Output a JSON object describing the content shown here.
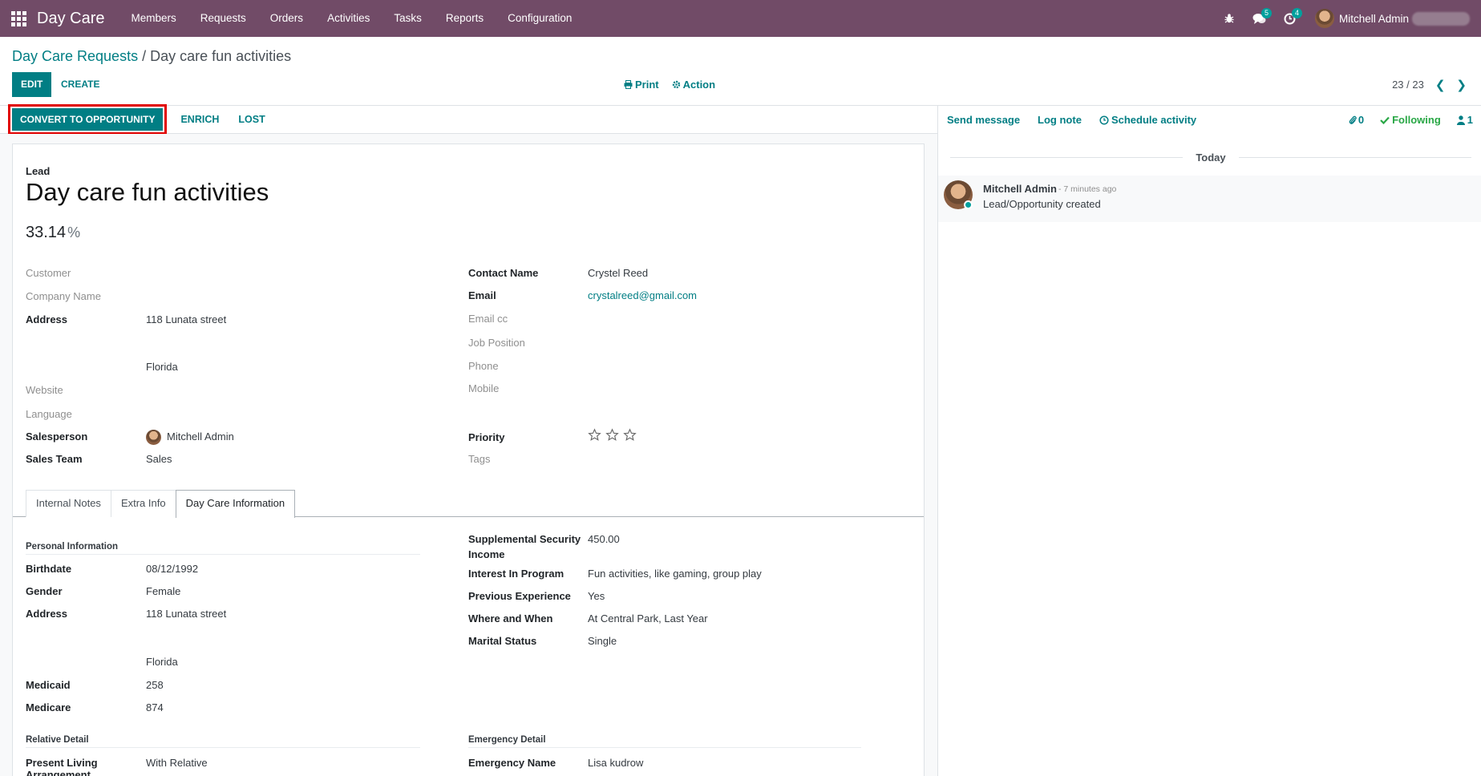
{
  "navbar": {
    "brand": "Day Care",
    "menu": [
      "Members",
      "Requests",
      "Orders",
      "Activities",
      "Tasks",
      "Reports",
      "Configuration"
    ],
    "messages_badge": "5",
    "activities_badge": "4",
    "user_name": "Mitchell Admin"
  },
  "control_panel": {
    "breadcrumb_parent": "Day Care Requests",
    "breadcrumb_sep": " / ",
    "breadcrumb_current": "Day care fun activities",
    "edit_label": "EDIT",
    "create_label": "CREATE",
    "print_label": "Print",
    "action_label": "Action",
    "pager": "23 / 23"
  },
  "statusbar": {
    "convert_label": "CONVERT TO OPPORTUNITY",
    "enrich_label": "ENRICH",
    "lost_label": "LOST"
  },
  "lead": {
    "type_label": "Lead",
    "title": "Day care fun activities",
    "probability": "33.14",
    "probability_unit": "%"
  },
  "fields_left": {
    "customer_label": "Customer",
    "company_label": "Company Name",
    "address_label": "Address",
    "address_street": "118 Lunata street",
    "address_state": "Florida",
    "website_label": "Website",
    "language_label": "Language",
    "salesperson_label": "Salesperson",
    "salesperson": "Mitchell Admin",
    "sales_team_label": "Sales Team",
    "sales_team": "Sales"
  },
  "fields_right": {
    "contact_label": "Contact Name",
    "contact": "Crystel Reed",
    "email_label": "Email",
    "email": "crystalreed@gmail.com",
    "email_cc_label": "Email cc",
    "job_label": "Job Position",
    "phone_label": "Phone",
    "mobile_label": "Mobile",
    "priority_label": "Priority",
    "priority_stars": 0,
    "tags_label": "Tags"
  },
  "tabs": [
    "Internal Notes",
    "Extra Info",
    "Day Care Information"
  ],
  "daycare": {
    "personal_title": "Personal Information",
    "birthdate_label": "Birthdate",
    "birthdate": "08/12/1992",
    "gender_label": "Gender",
    "gender": "Female",
    "address_label": "Address",
    "address_street": "118 Lunata street",
    "address_state": "Florida",
    "medicaid_label": "Medicaid",
    "medicaid": "258",
    "medicare_label": "Medicare",
    "medicare": "874",
    "ssi_label_1": "Supplemental Security",
    "ssi_label_2": "Income",
    "ssi": "450.00",
    "interest_label": "Interest In Program",
    "interest": "Fun activities, like gaming, group play",
    "experience_label": "Previous Experience",
    "experience": "Yes",
    "where_label": "Where and When",
    "where": "At Central Park, Last Year",
    "marital_label": "Marital Status",
    "marital": "Single",
    "relative_title": "Relative Detail",
    "living_label_1": "Present Living",
    "living_label_2": "Arrangement",
    "living": "With Relative",
    "emergency_title": "Emergency Detail",
    "emergency_name_label": "Emergency Name",
    "emergency_name": "Lisa kudrow"
  },
  "chatter": {
    "send_message": "Send message",
    "log_note": "Log note",
    "schedule_activity": "Schedule activity",
    "attachments": "0",
    "following": "Following",
    "followers": "1",
    "today": "Today",
    "message_author": "Mitchell Admin",
    "message_time": "- 7 minutes ago",
    "message_body": "Lead/Opportunity created"
  },
  "colors": {
    "brand": "#714B67",
    "primary": "#017e84",
    "badge": "#00A09D",
    "highlight": "#e10000",
    "following": "#28a745"
  }
}
